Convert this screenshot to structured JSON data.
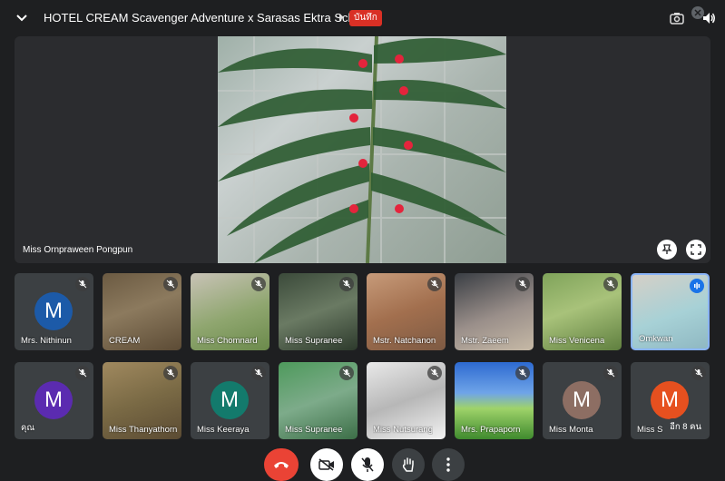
{
  "meeting": {
    "title": "HOTEL CREAM Scavenger Adventure x Sarasas Ektra School",
    "record_label": "บันทึก"
  },
  "main": {
    "speaker_name": "Miss Ornpraween Pongpun"
  },
  "tiles_row1": [
    {
      "name": "Mrs. Nithinun",
      "initial": "M",
      "color": "#1c5aa8",
      "type": "avatar"
    },
    {
      "name": "CREAM",
      "type": "video",
      "bg": "linear-gradient(160deg,#6b5a42,#8c7a5e 45%,#5c4b35)"
    },
    {
      "name": "Miss Chomnard",
      "type": "video",
      "bg": "linear-gradient(160deg,#c9c3b7,#8fa66f 55%,#6b8a4b)"
    },
    {
      "name": "Miss Supranee",
      "type": "video",
      "bg": "linear-gradient(160deg,#3b4a3a,#6a7a63 50%,#2d3a2c)"
    },
    {
      "name": "Mstr. Natchanon",
      "type": "video",
      "bg": "linear-gradient(160deg,#c79b7a,#a26f4e 50%,#7d5a43)"
    },
    {
      "name": "Mstr. Zaeem",
      "type": "video",
      "bg": "linear-gradient(160deg,#3a3e44,#9a8f8a 55%,#c6b9a6)"
    },
    {
      "name": "Miss Venicena",
      "type": "video",
      "bg": "linear-gradient(160deg,#7fa35a,#a8c27a 45%,#5f7f3f)"
    },
    {
      "name": "Omkwan",
      "type": "video",
      "bg": "linear-gradient(160deg,#d5cfc7,#a7d1d6 55%,#8fb8c2)",
      "active": true
    }
  ],
  "tiles_row2": [
    {
      "name": "คุณ",
      "initial": "M",
      "color": "#5b2bb0",
      "type": "avatar"
    },
    {
      "name": "Miss Thanyathorn",
      "type": "video",
      "bg": "linear-gradient(160deg,#a0895f,#7a6a45 50%,#5b4b33)"
    },
    {
      "name": "Miss Keeraya",
      "initial": "M",
      "color": "#137a6c",
      "type": "avatar"
    },
    {
      "name": "Miss Supranee",
      "type": "video",
      "bg": "linear-gradient(160deg,#4e9a5c,#7dab8a 50%,#3c6e47)"
    },
    {
      "name": "Miss Nutsurang",
      "type": "video",
      "bg": "linear-gradient(160deg,#e9e9e9,#b7b7b7 50%,#f2f2f2)"
    },
    {
      "name": "Mrs. Prapaporn",
      "type": "video",
      "bg": "linear-gradient(180deg,#2d6ad1 0%,#6fa4e8 40%,#9fd36a 60%,#3f8a2e 100%)"
    },
    {
      "name": "Miss Monta",
      "initial": "M",
      "color": "#8d6e63",
      "type": "avatar"
    },
    {
      "name": "Miss S",
      "initial": "M",
      "color": "#e6501f",
      "type": "avatar",
      "more": "อีก 8 คน"
    }
  ],
  "icons": {
    "collapse": "chevron-down-icon",
    "camera": "camera-icon",
    "volume": "volume-icon",
    "pin": "pin-icon",
    "fullscreen": "fullscreen-icon",
    "mute": "mic-off-icon",
    "end_call": "end-call-icon",
    "camera_off": "camera-off-icon",
    "mic_off": "mic-off-icon",
    "raise_hand": "raise-hand-icon",
    "more": "more-vert-icon"
  },
  "colors": {
    "end_call": "#ea4335",
    "record": "#d93025",
    "active_border": "#8ab4f8"
  }
}
